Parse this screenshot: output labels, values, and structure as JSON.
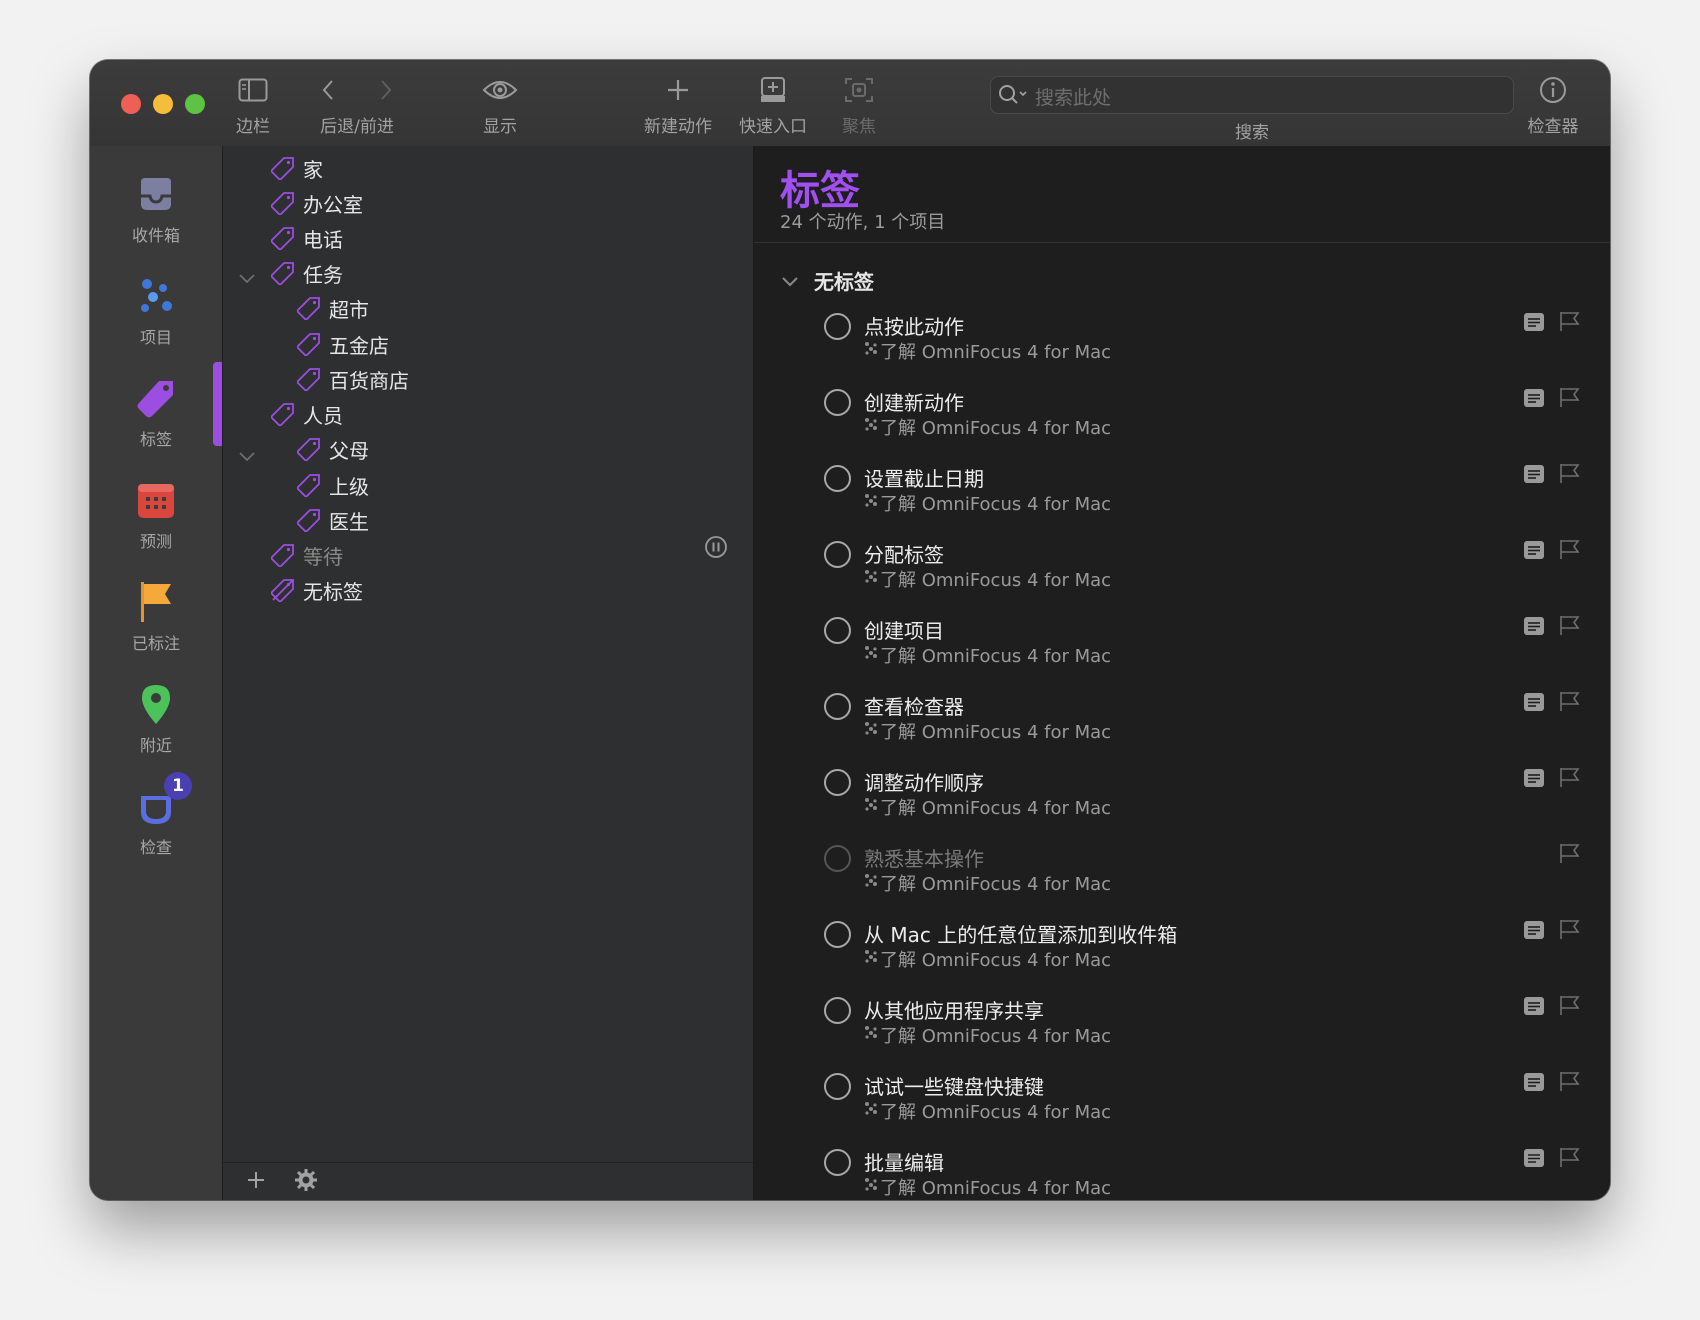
{
  "toolbar": {
    "sidebar_label": "边栏",
    "nav_label": "后退/前进",
    "view_label": "显示",
    "new_action_label": "新建动作",
    "quick_entry_label": "快速入口",
    "focus_label": "聚焦",
    "search_placeholder": "搜索此处",
    "search_label": "搜索",
    "inspector_label": "检查器"
  },
  "sidebar": {
    "items": [
      {
        "label": "收件箱",
        "icon": "inbox-icon"
      },
      {
        "label": "项目",
        "icon": "projects-icon"
      },
      {
        "label": "标签",
        "icon": "tag-icon"
      },
      {
        "label": "预测",
        "icon": "forecast-icon"
      },
      {
        "label": "已标注",
        "icon": "flag-icon"
      },
      {
        "label": "附近",
        "icon": "location-pin-icon"
      },
      {
        "label": "检查",
        "icon": "review-icon",
        "badge": "1"
      }
    ]
  },
  "tags": [
    {
      "name": "家"
    },
    {
      "name": "办公室"
    },
    {
      "name": "电话"
    },
    {
      "name": "任务"
    },
    {
      "name": "超市"
    },
    {
      "name": "五金店"
    },
    {
      "name": "百货商店"
    },
    {
      "name": "人员"
    },
    {
      "name": "父母"
    },
    {
      "name": "上级"
    },
    {
      "name": "医生"
    },
    {
      "name": "等待",
      "status": "on-hold"
    },
    {
      "name": "无标签"
    }
  ],
  "main": {
    "title": "标签",
    "subtitle": "24 个动作, 1 个项目",
    "group_label": "无标签",
    "project_name": "了解 OmniFocus 4 for Mac",
    "actions": [
      {
        "title": "点按此动作",
        "project": "了解 OmniFocus 4 for Mac"
      },
      {
        "title": "创建新动作",
        "project": "了解 OmniFocus 4 for Mac"
      },
      {
        "title": "设置截止日期",
        "project": "了解 OmniFocus 4 for Mac"
      },
      {
        "title": "分配标签",
        "project": "了解 OmniFocus 4 for Mac"
      },
      {
        "title": "创建项目",
        "project": "了解 OmniFocus 4 for Mac"
      },
      {
        "title": "查看检查器",
        "project": "了解 OmniFocus 4 for Mac"
      },
      {
        "title": "调整动作顺序",
        "project": "了解 OmniFocus 4 for Mac"
      },
      {
        "title": "熟悉基本操作",
        "project": "了解 OmniFocus 4 for Mac"
      },
      {
        "title": "从 Mac 上的任意位置添加到收件箱",
        "project": "了解 OmniFocus 4 for Mac"
      },
      {
        "title": "从其他应用程序共享",
        "project": "了解 OmniFocus 4 for Mac"
      },
      {
        "title": "试试一些键盘快捷键",
        "project": "了解 OmniFocus 4 for Mac"
      },
      {
        "title": "批量编辑",
        "project": "了解 OmniFocus 4 for Mac"
      }
    ]
  },
  "colors": {
    "accent": "#a14ff0",
    "tag_outline": "#9b4ee0"
  }
}
